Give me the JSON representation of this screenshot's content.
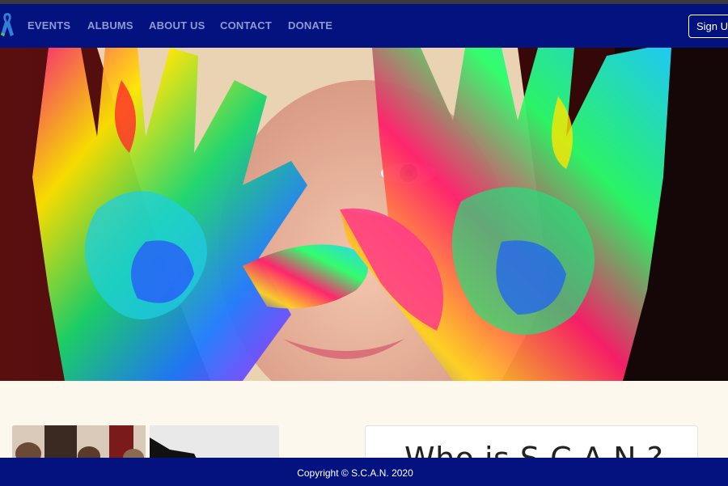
{
  "nav": {
    "links": [
      "EVENTS",
      "ALBUMS",
      "ABOUT US",
      "CONTACT",
      "DONATE"
    ],
    "signup_label": "Sign Up"
  },
  "main": {
    "card_title": "Who is S.C.A.N.?"
  },
  "footer": {
    "copyright": "Copyright © S.C.A.N. 2020"
  },
  "colors": {
    "navbar": "#03127e",
    "nav_link": "#8e9ad2",
    "page_background": "#fdf8ee",
    "footer": "#03127e"
  },
  "icons": {
    "logo": "awareness-ribbon-icon"
  }
}
